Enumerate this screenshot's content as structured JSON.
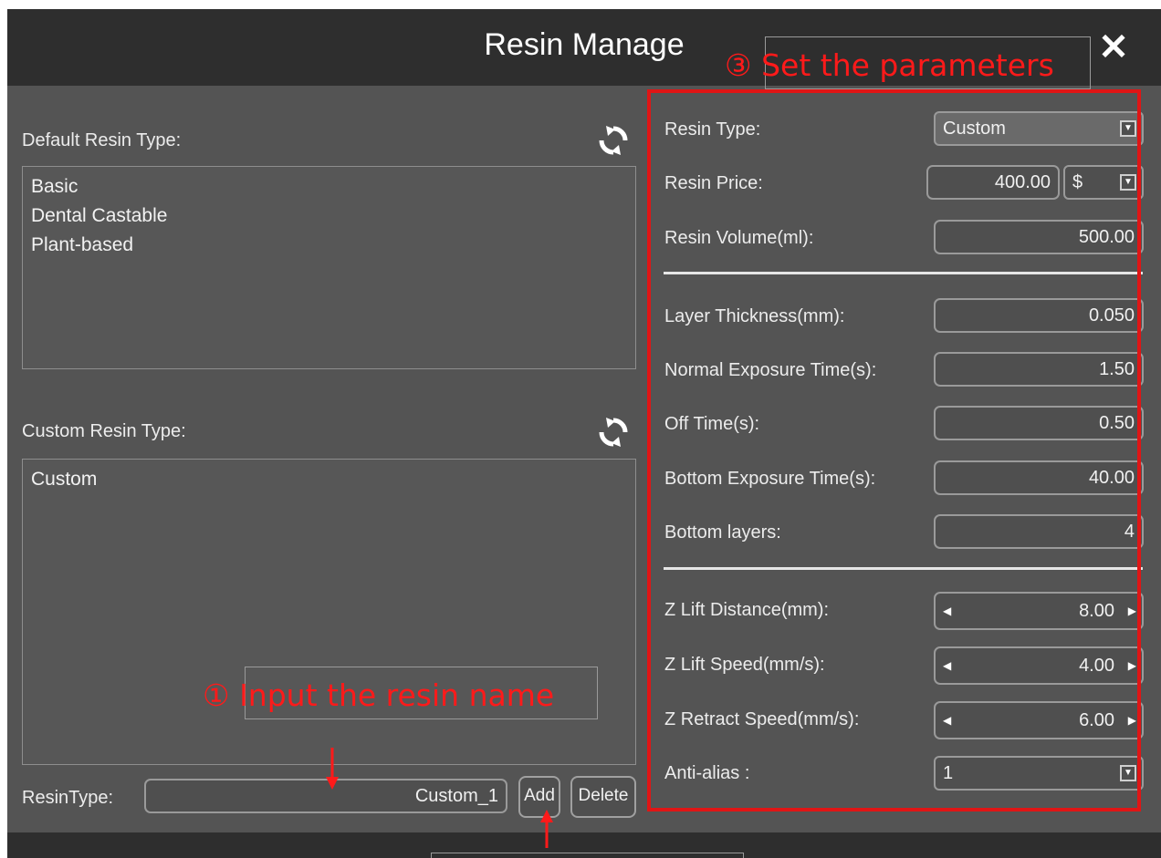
{
  "dialog": {
    "title": "Resin Manage",
    "close_icon": "close-icon"
  },
  "default_section": {
    "label": "Default Resin Type:",
    "refresh_icon": "refresh-icon",
    "items": [
      "Basic",
      "Dental Castable",
      "Plant-based"
    ]
  },
  "custom_section": {
    "label": "Custom Resin Type:",
    "refresh_icon": "refresh-icon",
    "items": [
      "Custom"
    ]
  },
  "resin_type_input": {
    "label": "ResinType:",
    "value": "Custom_1",
    "add_label": "Add",
    "delete_label": "Delete"
  },
  "params": {
    "resin_type": {
      "label": "Resin Type:",
      "value": "Custom"
    },
    "resin_price": {
      "label": "Resin Price:",
      "value": "400.00",
      "currency": "$"
    },
    "resin_volume": {
      "label": "Resin Volume(ml):",
      "value": "500.00"
    },
    "layer_thickness": {
      "label": "Layer Thickness(mm):",
      "value": "0.050"
    },
    "normal_exposure": {
      "label": "Normal Exposure Time(s):",
      "value": "1.50"
    },
    "off_time": {
      "label": "Off Time(s):",
      "value": "0.50"
    },
    "bottom_exposure": {
      "label": "Bottom Exposure Time(s):",
      "value": "40.00"
    },
    "bottom_layers": {
      "label": "Bottom layers:",
      "value": "4"
    },
    "z_lift_distance": {
      "label": "Z Lift Distance(mm):",
      "value": "8.00"
    },
    "z_lift_speed": {
      "label": "Z Lift Speed(mm/s):",
      "value": "4.00"
    },
    "z_retract_speed": {
      "label": "Z Retract Speed(mm/s):",
      "value": "6.00"
    },
    "anti_alias": {
      "label": "Anti-alias :",
      "value": "1"
    }
  },
  "annotations": {
    "step1": "① Input the resin name",
    "step3": "③ Set the parameters"
  },
  "colors": {
    "dialog_bg": "#545454",
    "titlebar_bg": "#2e2e2e",
    "annotation_red": "#e01515"
  }
}
